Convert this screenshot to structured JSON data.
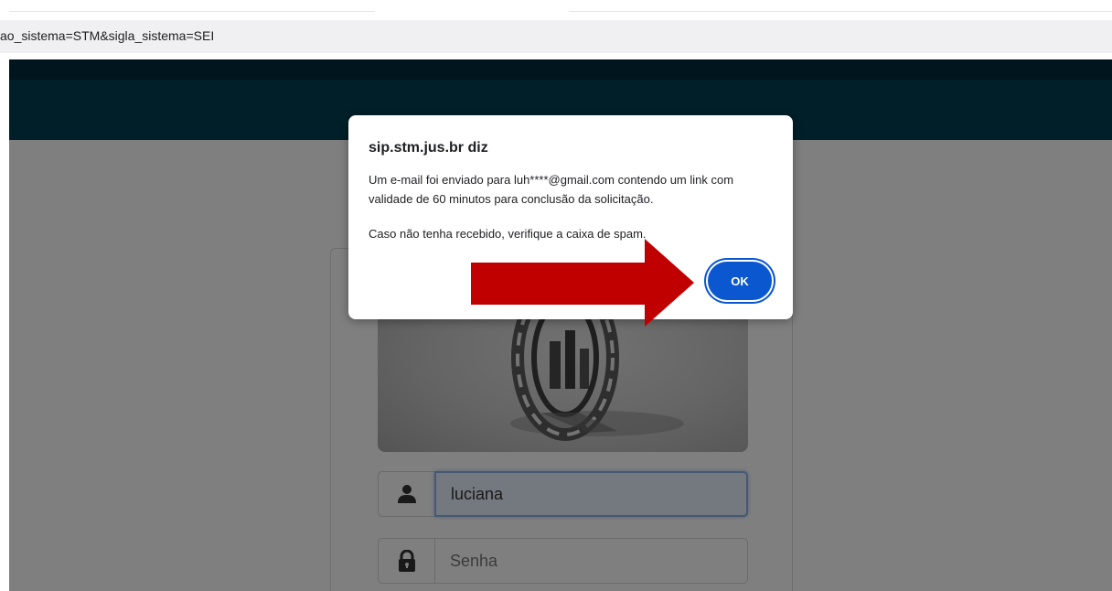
{
  "browser": {
    "url_visible": "ao_sistema=STM&sigla_sistema=SEI"
  },
  "colors": {
    "header": "#003e50",
    "ok_button": "#0b57d0",
    "arrow": "#c00000"
  },
  "login": {
    "logo_icon": "sei-logo",
    "username_value": "luciana",
    "password_placeholder": "Senha",
    "user_icon": "user-icon",
    "lock_icon": "lock-icon"
  },
  "dialog": {
    "title": "sip.stm.jus.br diz",
    "message_line1": "Um e-mail foi enviado para luh****@gmail.com contendo um link com validade de 60 minutos para conclusão da solicitação.",
    "message_line2": "Caso não tenha recebido, verifique a caixa de spam.",
    "ok_label": "OK"
  },
  "annotation": {
    "arrow_icon": "red-arrow-right"
  }
}
